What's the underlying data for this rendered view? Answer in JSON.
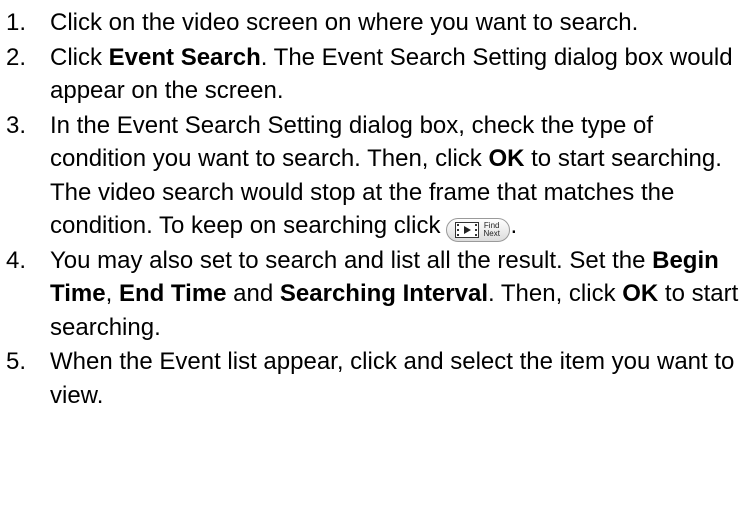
{
  "steps": [
    {
      "number": "1.",
      "text": "Click on the video screen on where you want to search."
    },
    {
      "number": "2.",
      "pre": "Click ",
      "bold": "Event Search",
      "post": ". The Event Search Setting dialog box would appear on the screen."
    },
    {
      "number": "3.",
      "pre": "In the Event Search Setting dialog box, check the type of condition you want to search. Then, click ",
      "bold": "OK",
      "post": " to start searching. The video search would stop at the frame that matches the condition. To keep on searching click",
      "button": {
        "icon": "film-play-icon",
        "label_line1": "Find",
        "label_line2": "Next"
      },
      "end": "."
    },
    {
      "number": "4.",
      "pre": "You may also set to search and list all the result. Set the ",
      "bold1": "Begin Time",
      "mid1": ", ",
      "bold2": "End Time",
      "mid2": " and ",
      "bold3": "Searching Interval",
      "mid3": ". Then, click ",
      "bold4": "OK",
      "post": " to start searching."
    },
    {
      "number": "5.",
      "text": "When the Event list appear, click and select the item you want to view."
    }
  ]
}
